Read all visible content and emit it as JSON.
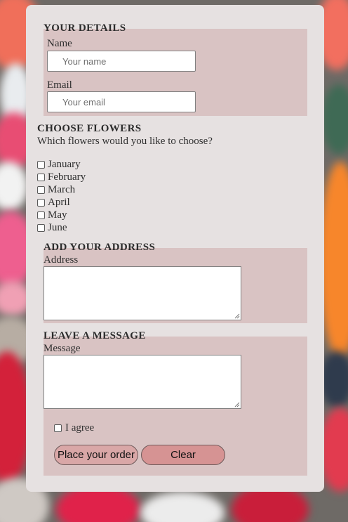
{
  "details": {
    "legend": "YOUR DETAILS",
    "name_label": "Name",
    "name_placeholder": "Your name",
    "email_label": "Email",
    "email_placeholder": "Your email"
  },
  "flowers": {
    "legend": "CHOOSE FLOWERS",
    "question": "Which flowers would you like to choose?",
    "options": [
      "January",
      "February",
      "March",
      "April",
      "May",
      "June"
    ]
  },
  "address": {
    "legend": "ADD YOUR ADDRESS",
    "label": "Address"
  },
  "message": {
    "legend": "LEAVE A MESSAGE",
    "label": "Message",
    "agree_label": "I agree",
    "submit_label": "Place your order",
    "clear_label": "Clear"
  },
  "colors": {
    "card": "#e6e1e1",
    "section": "#d9c3c3",
    "submit_button": "#d9a7a7",
    "clear_button": "#d69393"
  }
}
